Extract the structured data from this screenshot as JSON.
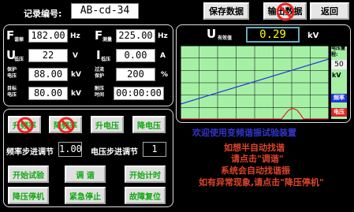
{
  "header": {
    "record_label": "记录编号:",
    "record_value": "AB-cd-34",
    "save_button": "保存数据",
    "export_button": "输出数据",
    "back_button": "返回"
  },
  "params": {
    "f_harmonic": {
      "sym": "F",
      "sub": "谐振",
      "value": "182.00",
      "unit": "Hz"
    },
    "f_measured": {
      "sym": "F",
      "sub": "测量",
      "value": "225.00",
      "unit": "Hz"
    },
    "u_low": {
      "sym": "U",
      "sub": "低压",
      "value": "22",
      "unit": "V"
    },
    "i_low": {
      "sym": "I",
      "sub": "低压",
      "value": "0.00",
      "unit": "A"
    },
    "protect_voltage": {
      "label_line1": "保护",
      "label_line2": "电压",
      "value": "88.00",
      "unit": "kV"
    },
    "overcurrent_protect": {
      "label_line1": "过流",
      "label_line2": "保护",
      "value": "200",
      "unit": "%"
    },
    "target_voltage": {
      "label_line1": "目标",
      "label_line2": "电压",
      "value": "80.00",
      "unit": "kV"
    },
    "withstand_time": {
      "label_line1": "耐压",
      "label_line2": "时间",
      "value": "00:00:00"
    }
  },
  "controls": {
    "raise_freq": "升频率",
    "lower_freq": "降频率",
    "raise_voltage": "升电压",
    "lower_voltage": "降电压",
    "freq_step_label": "频率步进调节",
    "freq_step_value": "1.00",
    "volt_step_label": "电压步进调节",
    "volt_step_value": "1",
    "start_test": "开始试验",
    "tune": "调 谐",
    "start_timer": "开始计时",
    "lower_stop": "降压停机",
    "emergency_stop": "紧急停止",
    "fault_reset": "故障复位"
  },
  "meter": {
    "label": "U",
    "sub": "有效值",
    "value": "0.29",
    "unit": "kV"
  },
  "chart": {
    "range_label": "电压量程:",
    "range_value": "50",
    "range_unit": "kV",
    "freq_label": "频率",
    "volt_label": "电压"
  },
  "messages": {
    "welcome": "欢迎使用变频谐振试验装置",
    "line1": "如想半自动找谐",
    "line2": "请点击\"调谐\"",
    "line3": "系统会自动找谐振",
    "line4": "如有异常现象,请点击\"降压停机\""
  },
  "colors": {
    "plot_bg": "#a6f0a6",
    "grid": "#000000",
    "freq_line": "#2233dd",
    "volt_line": "#dd2222",
    "message": "#e0442a",
    "meter_value": "#ffff00"
  }
}
